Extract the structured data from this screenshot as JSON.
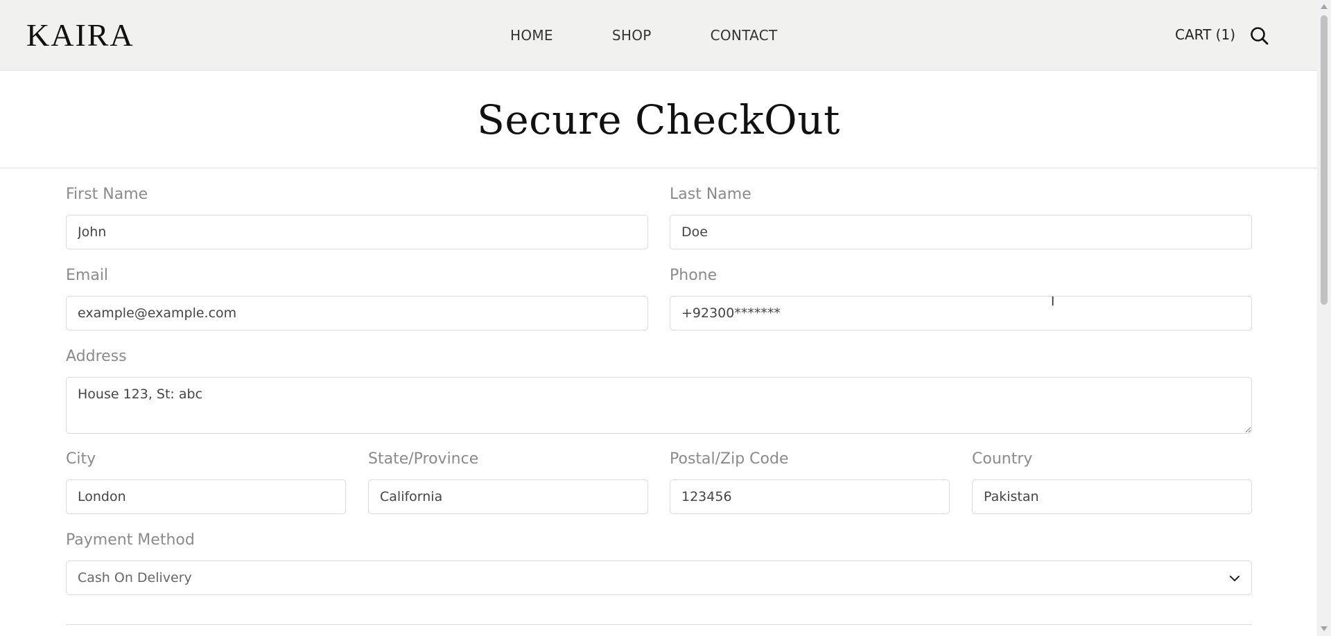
{
  "header": {
    "logo": "KAIRA",
    "nav": [
      {
        "label": "HOME"
      },
      {
        "label": "SHOP"
      },
      {
        "label": "CONTACT"
      }
    ],
    "cart_label": "CART (1)",
    "search_icon": "search-icon"
  },
  "page": {
    "title": "Secure CheckOut"
  },
  "form": {
    "first_name": {
      "label": "First Name",
      "value": "John"
    },
    "last_name": {
      "label": "Last Name",
      "value": "Doe"
    },
    "email": {
      "label": "Email",
      "value": "example@example.com"
    },
    "phone": {
      "label": "Phone",
      "value": "+92300*******"
    },
    "address": {
      "label": "Address",
      "value": "House 123, St: abc"
    },
    "city": {
      "label": "City",
      "value": "London"
    },
    "state": {
      "label": "State/Province",
      "value": "California"
    },
    "postal": {
      "label": "Postal/Zip Code",
      "value": "123456"
    },
    "country": {
      "label": "Country",
      "value": "Pakistan"
    },
    "payment": {
      "label": "Payment Method",
      "value": "Cash On Delivery"
    }
  }
}
